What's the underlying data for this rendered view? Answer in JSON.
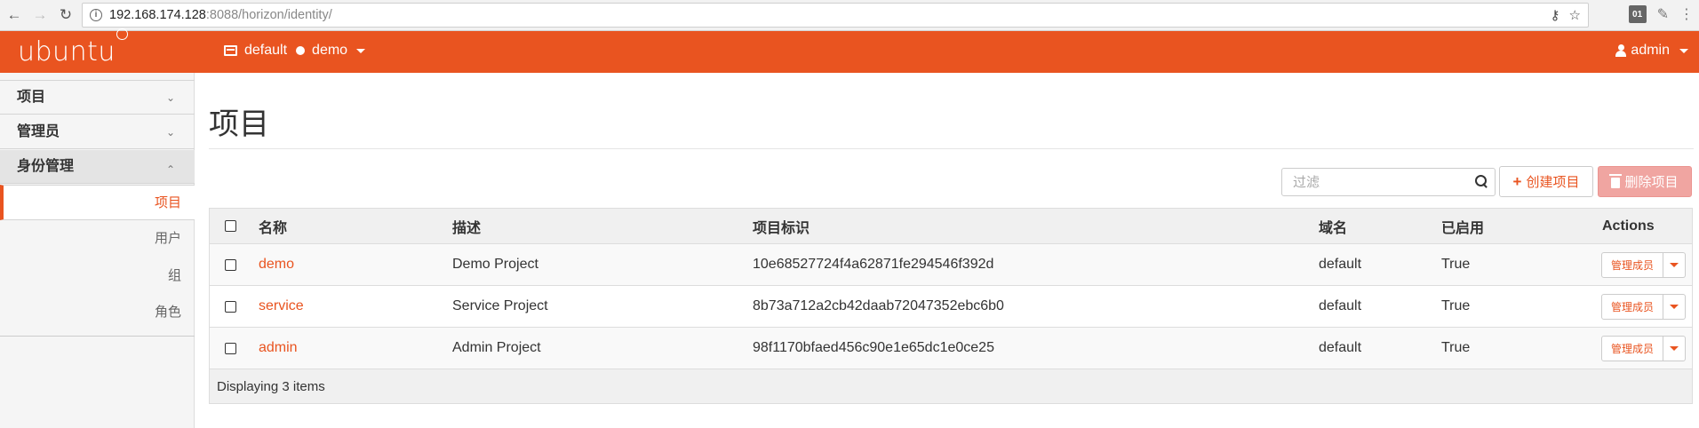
{
  "browser": {
    "url_host": "192.168.174.128",
    "url_rest": ":8088/horizon/identity/",
    "ext_badge": "01"
  },
  "topbar": {
    "logo": "ubuntu",
    "domain": "default",
    "project": "demo",
    "user": "admin",
    "brand_color": "#e95420"
  },
  "sidebar": {
    "groups": [
      {
        "label": "项目"
      },
      {
        "label": "管理员"
      },
      {
        "label": "身份管理"
      }
    ],
    "items": [
      {
        "label": "项目"
      },
      {
        "label": "用户"
      },
      {
        "label": "组"
      },
      {
        "label": "角色"
      }
    ]
  },
  "main": {
    "title": "项目",
    "filter_placeholder": "过滤",
    "create_label": "创建项目",
    "delete_label": "删除项目"
  },
  "table": {
    "headers": {
      "name": "名称",
      "desc": "描述",
      "id": "项目标识",
      "domain": "域名",
      "enabled": "已启用",
      "actions": "Actions"
    },
    "rows": [
      {
        "name": "demo",
        "desc": "Demo Project",
        "id": "10e68527724f4a62871fe294546f392d",
        "domain": "default",
        "enabled": "True",
        "action": "管理成员"
      },
      {
        "name": "service",
        "desc": "Service Project",
        "id": "8b73a712a2cb42daab72047352ebc6b0",
        "domain": "default",
        "enabled": "True",
        "action": "管理成员"
      },
      {
        "name": "admin",
        "desc": "Admin Project",
        "id": "98f1170bfaed456c90e1e65dc1e0ce25",
        "domain": "default",
        "enabled": "True",
        "action": "管理成员"
      }
    ],
    "footer": "Displaying 3 items"
  }
}
